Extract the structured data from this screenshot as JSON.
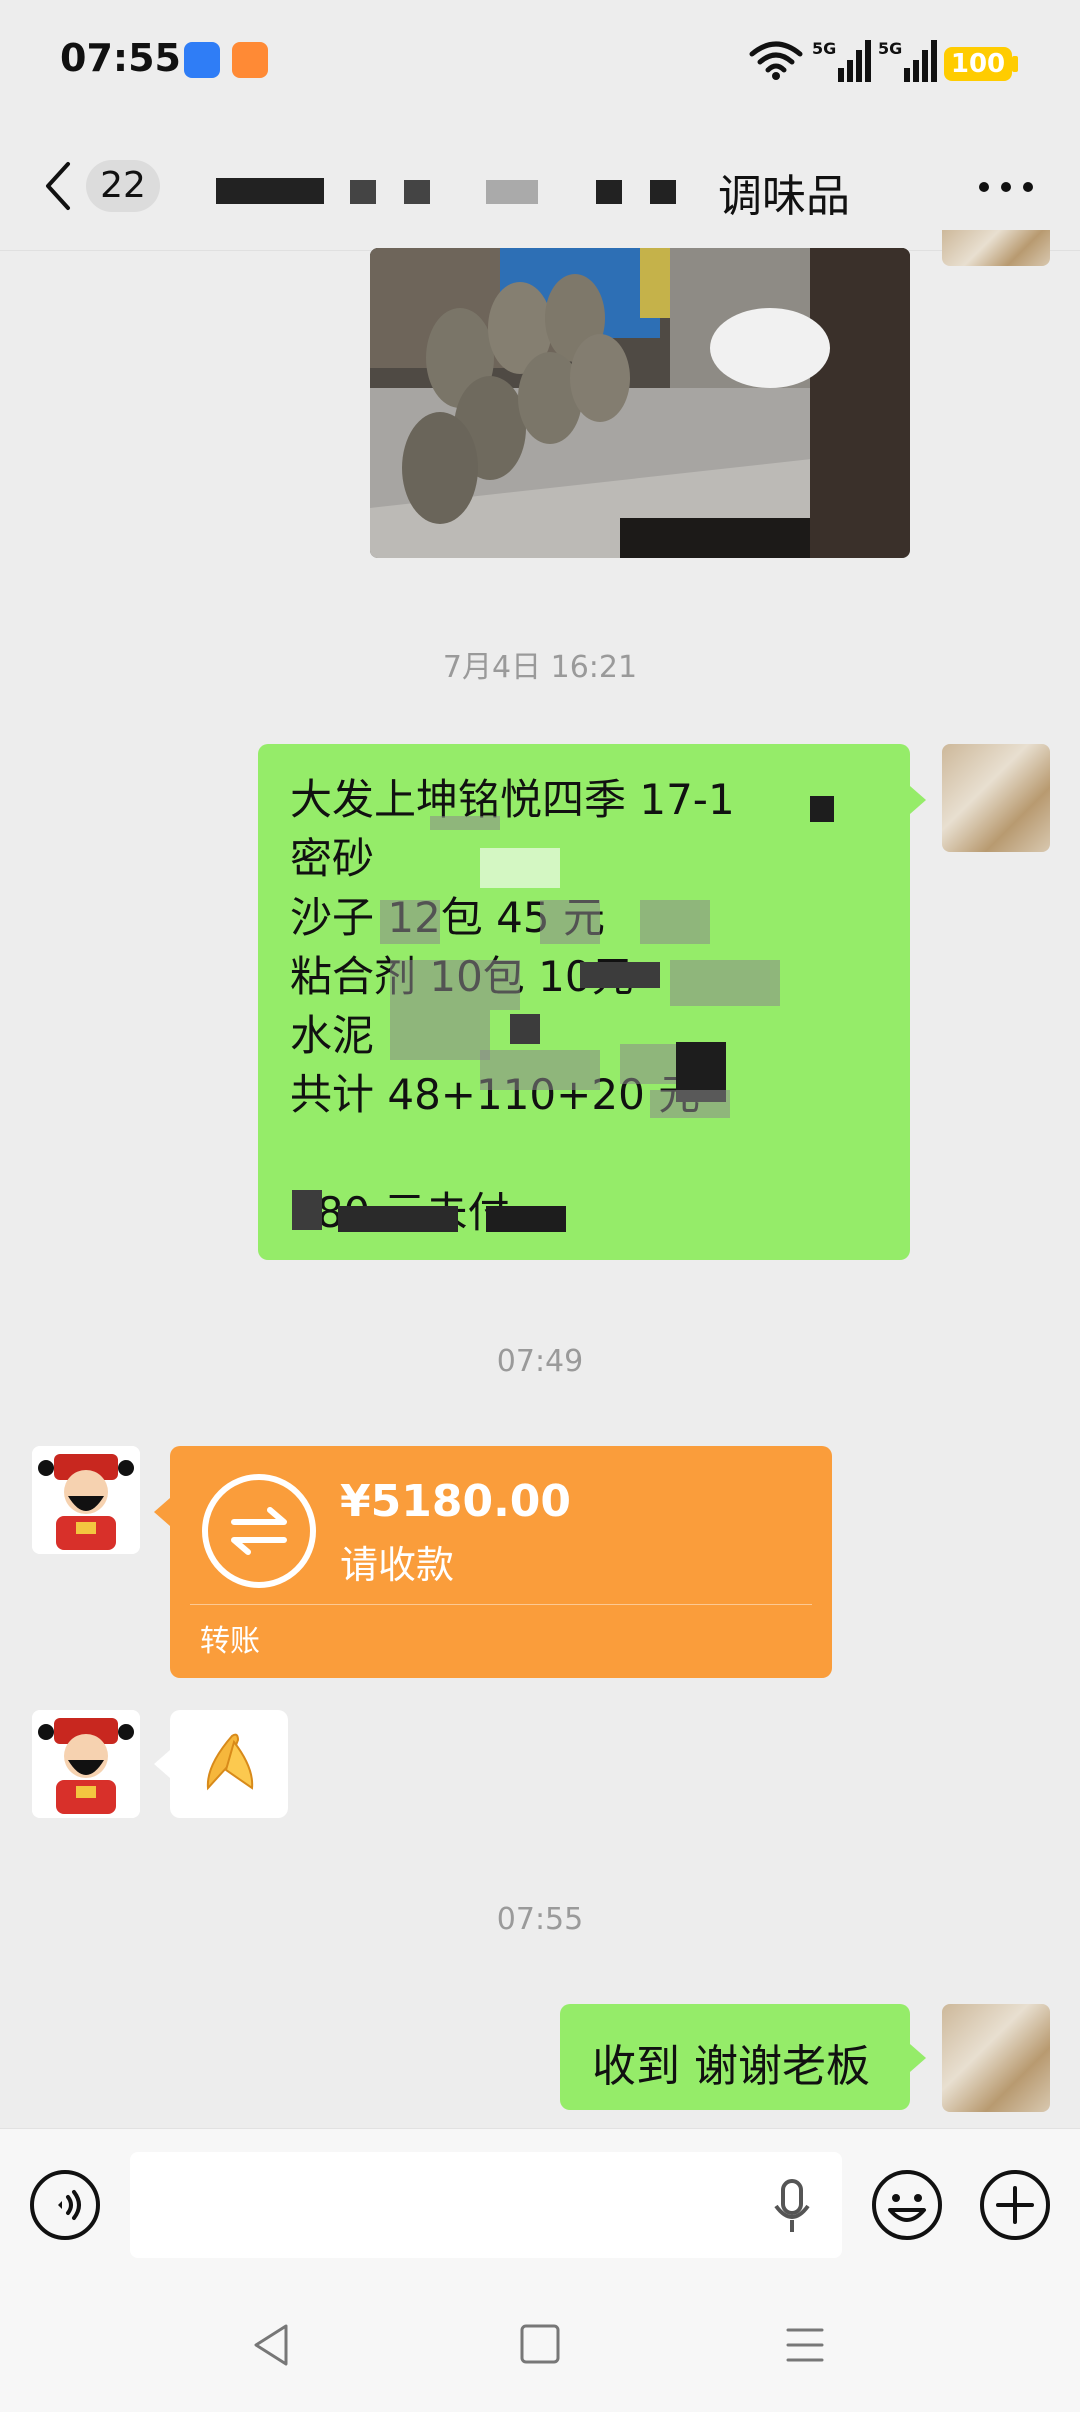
{
  "status_bar": {
    "time": "07:55",
    "network1": "5G",
    "network2": "5G",
    "battery": "100",
    "icons": [
      "wifi-icon",
      "signal-icon",
      "battery-icon"
    ]
  },
  "header": {
    "back_icon": "chevron-left-icon",
    "unread_count": "22",
    "title": "调味品",
    "more_icon": "more-horizontal-icon"
  },
  "messages": {
    "timestamp1": "7月4日 16:21",
    "order_lines": [
      "大发上坤铭悦四季 17-1",
      "密砂",
      "沙子    12包    45    元",
      "粘合剂 10包    10元",
      "水泥",
      "共计 48+110+20         元",
      "",
      "                            180 元未付"
    ],
    "timestamp2": "07:49",
    "transfer": {
      "amount": "¥5180.00",
      "status": "请收款",
      "label": "转账"
    },
    "reply_emoji": "🙏",
    "timestamp3": "07:55",
    "reply_text": "收到 谢谢老板"
  },
  "input_bar": {
    "placeholder": "",
    "icons": [
      "voice-icon",
      "microphone-icon",
      "emoji-icon",
      "plus-icon"
    ]
  },
  "nav_bar": {
    "icons": [
      "back-triangle-icon",
      "home-square-icon",
      "menu-lines-icon"
    ]
  },
  "colors": {
    "background": "#ededed",
    "sent_bubble": "#95ec69",
    "transfer_card": "#fa9d3b"
  }
}
